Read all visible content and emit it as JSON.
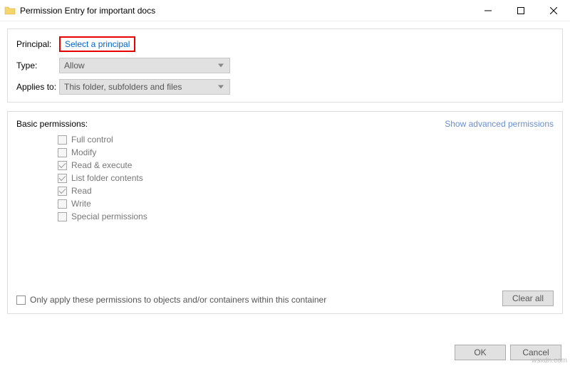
{
  "window": {
    "title": "Permission Entry for important docs"
  },
  "principal": {
    "label": "Principal:",
    "link": "Select a principal"
  },
  "type": {
    "label": "Type:",
    "value": "Allow"
  },
  "applies_to": {
    "label": "Applies to:",
    "value": "This folder, subfolders and files"
  },
  "permissions": {
    "title": "Basic permissions:",
    "advanced_link": "Show advanced permissions",
    "items": [
      {
        "label": "Full control",
        "checked": false
      },
      {
        "label": "Modify",
        "checked": false
      },
      {
        "label": "Read & execute",
        "checked": true
      },
      {
        "label": "List folder contents",
        "checked": true
      },
      {
        "label": "Read",
        "checked": true
      },
      {
        "label": "Write",
        "checked": false
      },
      {
        "label": "Special permissions",
        "checked": false
      }
    ],
    "only_apply": "Only apply these permissions to objects and/or containers within this container",
    "clear_all": "Clear all"
  },
  "buttons": {
    "ok": "OK",
    "cancel": "Cancel"
  },
  "watermark": "wsxdn.com"
}
